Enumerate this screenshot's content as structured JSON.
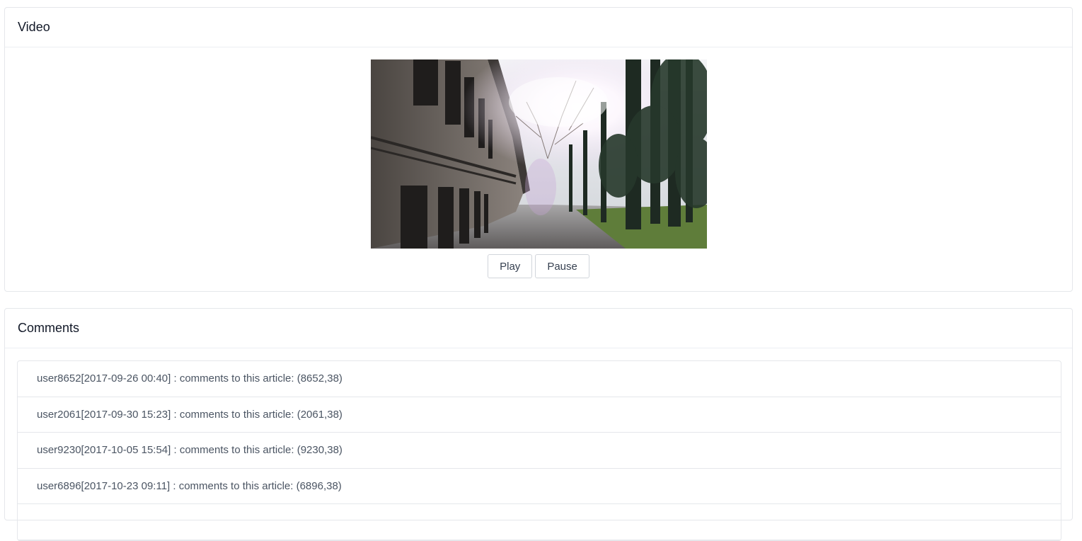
{
  "video_panel": {
    "title": "Video",
    "play_label": "Play",
    "pause_label": "Pause"
  },
  "comments_panel": {
    "title": "Comments",
    "items": [
      {
        "text": "user8652[2017-09-26 00:40] : comments to this article: (8652,38)"
      },
      {
        "text": "user2061[2017-09-30 15:23] : comments to this article: (2061,38)"
      },
      {
        "text": "user9230[2017-10-05 15:54] : comments to this article: (9230,38)"
      },
      {
        "text": "user6896[2017-10-23 09:11] : comments to this article: (6896,38)"
      },
      {
        "text": ""
      }
    ]
  }
}
